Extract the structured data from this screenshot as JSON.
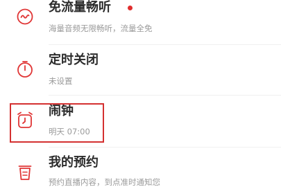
{
  "colors": {
    "accent": "#e02e2e",
    "icon": "#e03535",
    "title": "#2b2b2b",
    "subtitle": "#9a9a9a"
  },
  "items": [
    {
      "title": "免流量畅听",
      "subtitle": "海量音频无限畅听，流量全免",
      "icon": "waveform-circle-icon",
      "badge_dot": true
    },
    {
      "title": "定时关闭",
      "subtitle": "未设置",
      "icon": "timer-icon",
      "badge_dot": false
    },
    {
      "title": "闹钟",
      "subtitle": "明天 07:00",
      "icon": "alarm-clock-icon",
      "badge_dot": false,
      "highlighted": true
    },
    {
      "title": "我的预约",
      "subtitle": "预约直播内容，到点准时通知您",
      "icon": "reservation-cup-icon",
      "badge_dot": false
    }
  ]
}
